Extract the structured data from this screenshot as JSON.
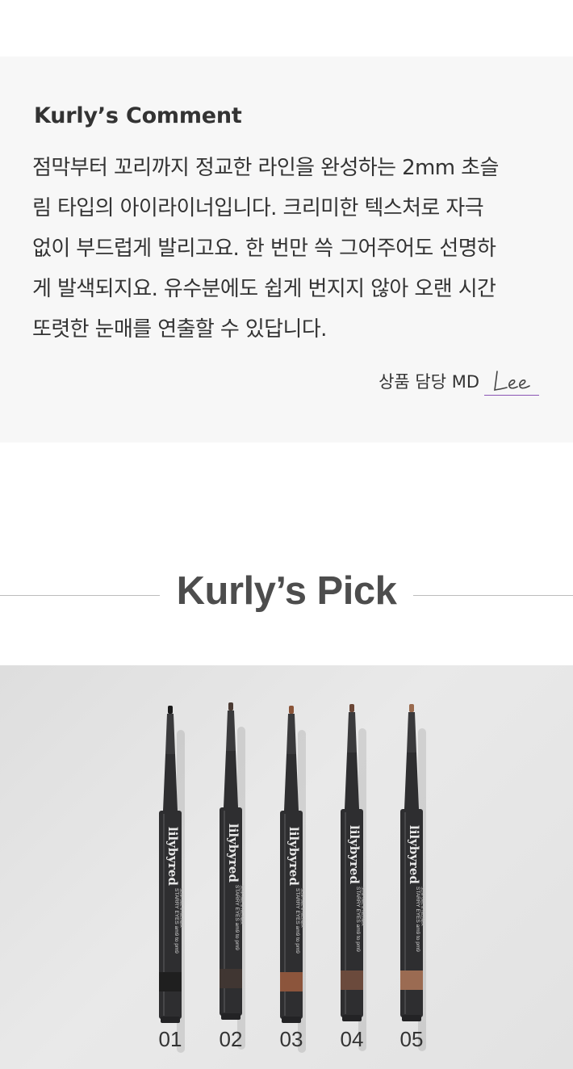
{
  "comment": {
    "title": "Kurly’s Comment",
    "lines": [
      "점막부터 꼬리까지 정교한 라인을 완성하는 2mm 초슬",
      "림 타입의 아이라이너입니다. 크리미한 텍스처로 자극",
      "없이 부드럽게 발리고요. 한 번만 쓱 그어주어도 선명하",
      "게 발색되지요. 유수분에도 쉽게 번지지 않아 오랜 시간",
      "또렷한 눈매를 연출할 수 있답니다."
    ],
    "signature_label": "상품 담당 MD",
    "signature_name": "Lee"
  },
  "pick": {
    "title": "Kurly’s Pick"
  },
  "products": {
    "brand": "lilybyred",
    "line": "STARRY EYES am9 to pm9",
    "subline": "SLIM GEL EYELINER",
    "items": [
      {
        "number": "01",
        "tip_color": "#1a1a1a",
        "band_color": "#1f1f1f"
      },
      {
        "number": "02",
        "tip_color": "#4a3a33",
        "band_color": "#403632"
      },
      {
        "number": "03",
        "tip_color": "#8a5438",
        "band_color": "#8c553c"
      },
      {
        "number": "04",
        "tip_color": "#6a4636",
        "band_color": "#6b4a3c"
      },
      {
        "number": "05",
        "tip_color": "#9a6a4e",
        "band_color": "#9b6b52"
      }
    ]
  },
  "colors": {
    "panel_bg": "#f7f7f7",
    "accent_purple": "#8b54b4",
    "pencil_body": "#2e2e30"
  }
}
